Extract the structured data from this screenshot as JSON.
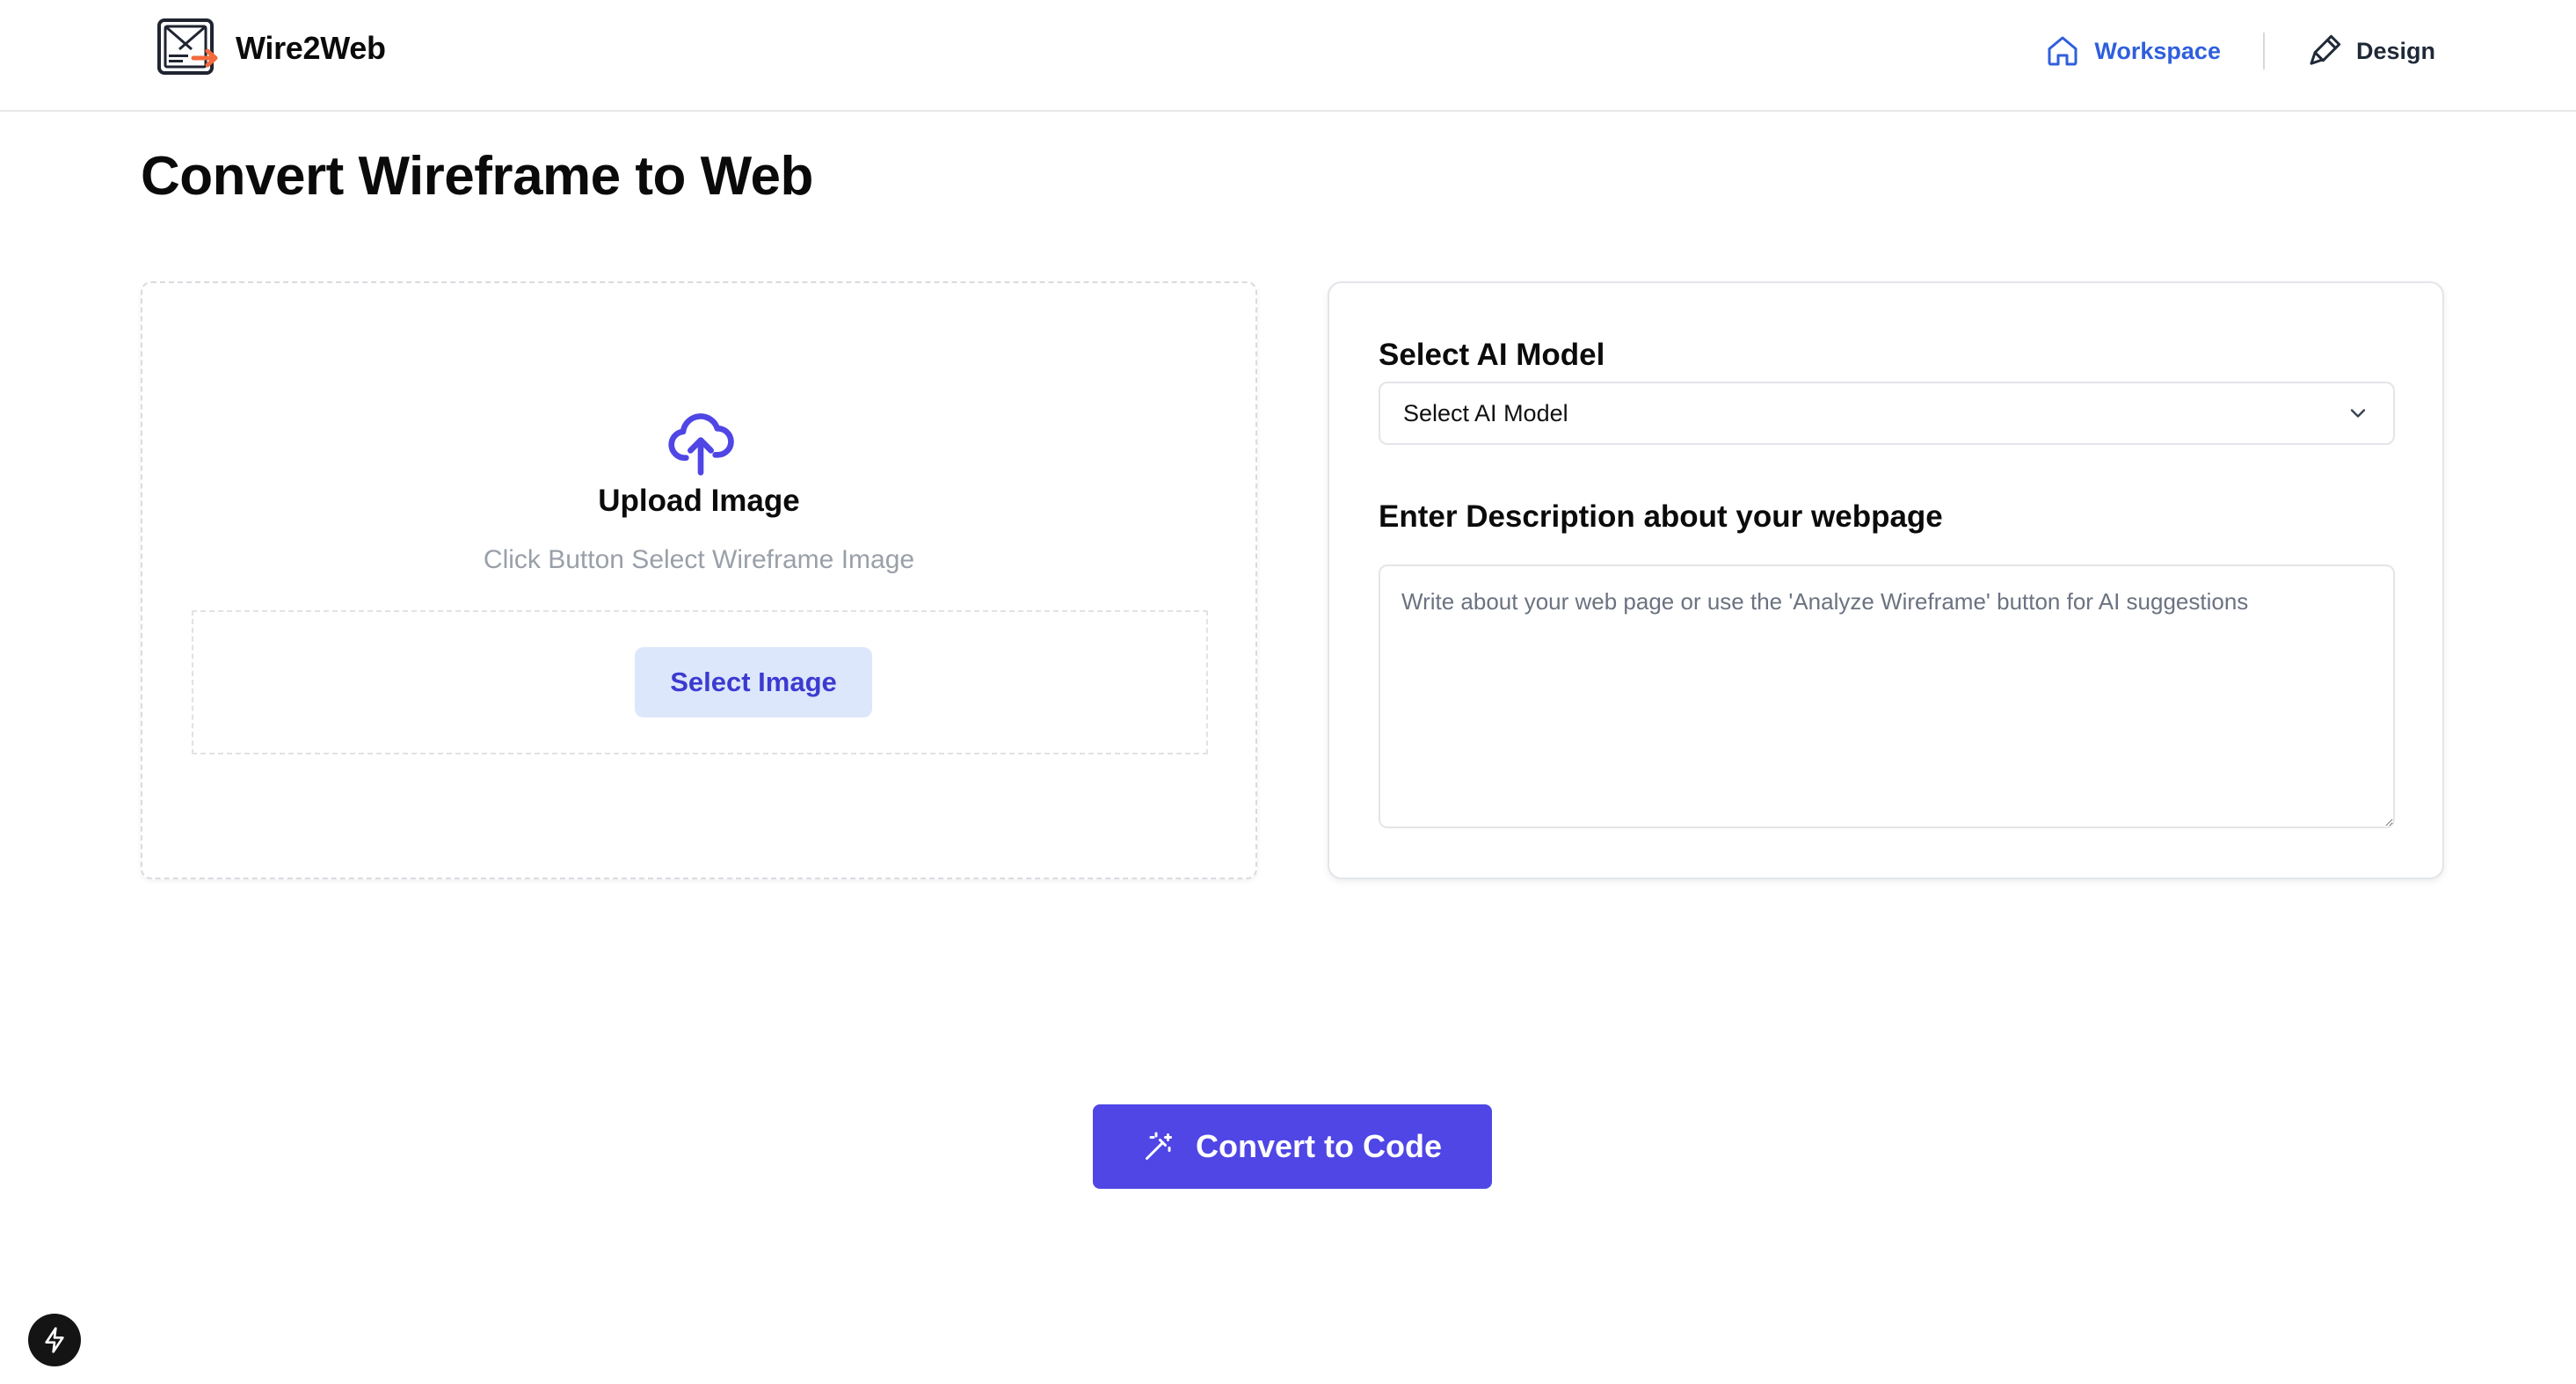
{
  "header": {
    "brand_name": "Wire2Web",
    "nav": {
      "workspace_label": "Workspace",
      "design_label": "Design",
      "active": "Workspace"
    }
  },
  "page": {
    "title": "Convert Wireframe to Web"
  },
  "upload": {
    "title": "Upload Image",
    "hint": "Click Button Select Wireframe Image",
    "button_label": "Select Image"
  },
  "settings": {
    "model_label": "Select AI Model",
    "model_selected": "Select AI Model",
    "description_label": "Enter Description about your webpage",
    "description_value": "",
    "description_placeholder": "Write about your web page or use the 'Analyze Wireframe' button for AI suggestions"
  },
  "actions": {
    "convert_label": "Convert to Code"
  },
  "icons": {
    "logo": "wireframe-logo-icon",
    "workspace": "home-icon",
    "design": "paintbrush-icon",
    "upload": "cloud-upload-icon",
    "select_chevron": "chevron-down-icon",
    "convert": "magic-wand-icon",
    "dev_badge": "lightning-bolt-icon"
  },
  "colors": {
    "accent": "#4f46e5",
    "nav_active": "#2f5fdc",
    "upload_icon": "#4f46e5",
    "select_button_bg": "#dde7fb",
    "select_button_text": "#3c3bd0",
    "logo_arrow": "#f26a3d"
  }
}
